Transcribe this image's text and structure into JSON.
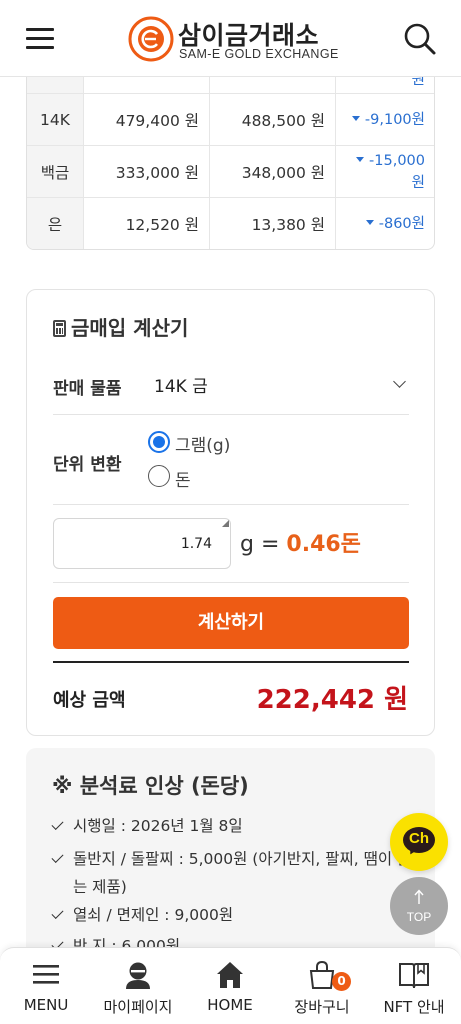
{
  "header": {
    "logo_ko": "삼이금거래소",
    "logo_en": "SAM-E GOLD EXCHANGE",
    "logo_ring_text": "SAM-E GOLD EXCHANGE",
    "menu_icon": "hamburger-icon",
    "search_icon": "search-icon"
  },
  "price_table": {
    "partial_row": {
      "diff_tail": "원"
    },
    "rows": [
      {
        "name": "14K",
        "buy": "479,400 원",
        "sell": "488,500 원",
        "diff": "-9,100원"
      },
      {
        "name": "백금",
        "buy": "333,000 원",
        "sell": "348,000 원",
        "diff": "-15,000",
        "diff_unit": "원"
      },
      {
        "name": "은",
        "buy": "12,520 원",
        "sell": "13,380 원",
        "diff": "-860원"
      }
    ]
  },
  "calculator": {
    "title": "금매입 계산기",
    "item_label": "판매 물품",
    "item_selected": "14K 금",
    "unit_label": "단위 변환",
    "unit_options": [
      "그램(g)",
      "돈"
    ],
    "unit_selected_index": 0,
    "amount_value": "1.74",
    "unit_symbol": "g",
    "equals": "=",
    "converted_value": "0.46돈",
    "button_label": "계산하기",
    "estimate_label": "예상 금액",
    "estimate_value": "222,442 원"
  },
  "notice": {
    "title": "※ 분석료 인상 (돈당)",
    "items": [
      "시행일 : 2026년 1월 8일",
      "돌반지 / 돌팔찌 : 5,000원 (아기반지, 팔찌, 땜이 없는 제품)",
      "열쇠 / 면제인 : 9,000원",
      "반 지 : 6,000원"
    ]
  },
  "floating": {
    "kakao_label": "Ch",
    "top_label": "TOP"
  },
  "bottom_nav": {
    "items": [
      {
        "label": "MENU",
        "icon": "menu-icon"
      },
      {
        "label": "마이페이지",
        "icon": "user-icon"
      },
      {
        "label": "HOME",
        "icon": "home-icon"
      },
      {
        "label": "장바구니",
        "icon": "cart-icon",
        "badge": "0"
      },
      {
        "label": "NFT 안내",
        "icon": "book-icon"
      }
    ]
  },
  "colors": {
    "accent_orange": "#ee5b14",
    "price_red": "#c4141b",
    "diff_blue": "#2a6fd0",
    "kakao_yellow": "#fae100"
  }
}
